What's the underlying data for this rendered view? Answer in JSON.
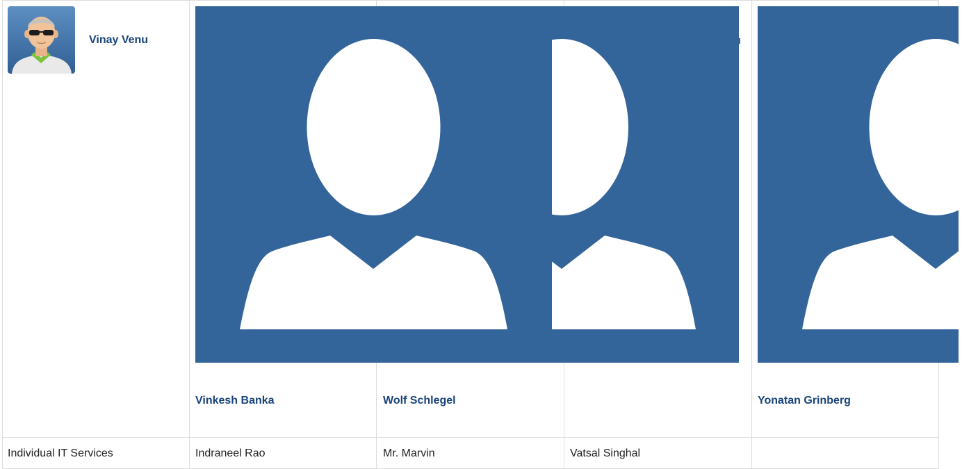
{
  "people_row": {
    "cells": [
      {
        "name": "Vinay Venu",
        "avatar": "custom-avatar-sunglasses-icon"
      },
      {
        "name": "Vinkesh Banka",
        "avatar": "default-user-silhouette-icon"
      },
      {
        "name": "Wolf Schlegel",
        "avatar": "default-user-silhouette-icon"
      },
      {
        "name": "",
        "avatar": ""
      },
      {
        "name": "Yonatan Grinberg",
        "avatar": "default-user-silhouette-icon"
      }
    ]
  },
  "text_row": {
    "cells": [
      "Individual IT Services",
      "Indraneel Rao",
      "Mr. Marvin",
      "Vatsal Singhal",
      ""
    ]
  },
  "colors": {
    "placeholder_bg": "#33649a",
    "link": "#18437a",
    "grid": "#dddddd"
  }
}
